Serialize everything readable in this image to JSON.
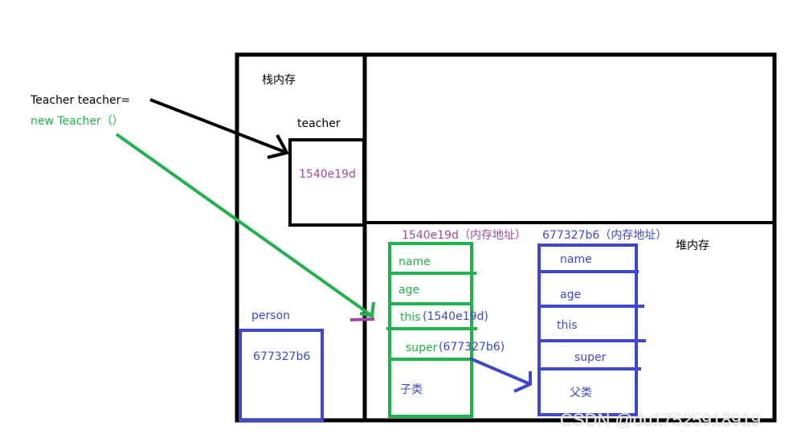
{
  "colors": {
    "stack": "#000000",
    "green": "#22b14c",
    "blue": "#3f48cc",
    "purple": "#a349a4"
  },
  "code": {
    "line1": "Teacher teacher=",
    "line2": "new Teacher（）"
  },
  "stack": {
    "title": "栈内存",
    "teacher_label": "teacher",
    "teacher_value": "1540e19d",
    "person_label": "person",
    "person_value": "677327b6"
  },
  "heap": {
    "title": "堆内存",
    "child": {
      "address": "1540e19d（内存地址）",
      "fields": [
        "name",
        "age",
        "this",
        "super"
      ],
      "this_value": "(1540e19d)",
      "super_value": "(677327b6)",
      "label": "子类"
    },
    "parent": {
      "address": "677327b6（内存地址）",
      "fields": [
        "name",
        "age",
        "this",
        "super"
      ],
      "label": "父类"
    }
  },
  "watermark": "CSDN @du17525918919"
}
